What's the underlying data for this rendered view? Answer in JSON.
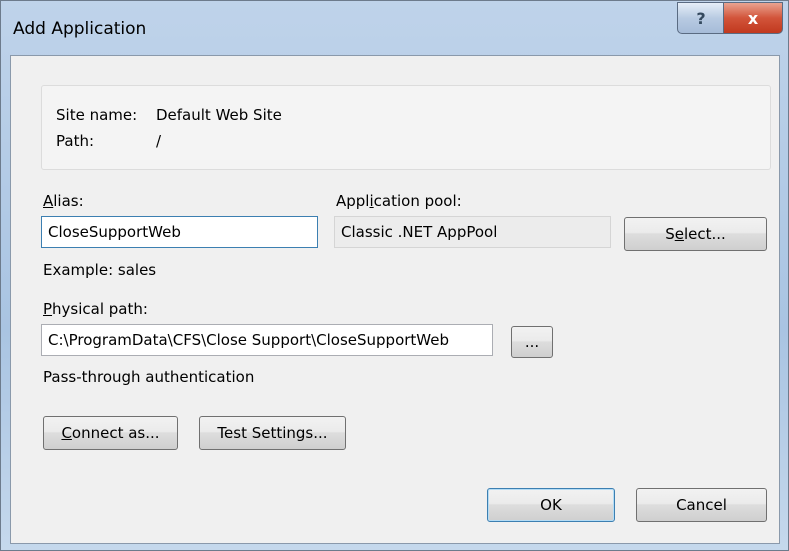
{
  "window": {
    "title": "Add Application",
    "help_glyph": "?",
    "close_glyph": "x"
  },
  "site_info": {
    "site_name_label": "Site name:",
    "site_name_value": "Default Web Site",
    "path_label": "Path:",
    "path_value": "/"
  },
  "alias": {
    "label_accel": "A",
    "label_rest": "lias:",
    "value": "CloseSupportWeb",
    "example": "Example: sales"
  },
  "app_pool": {
    "label_pre": "Appl",
    "label_accel": "i",
    "label_post": "cation pool:",
    "value": "Classic .NET AppPool",
    "select_pre": "S",
    "select_accel": "e",
    "select_post": "lect..."
  },
  "physical_path": {
    "label_accel": "P",
    "label_rest": "hysical path:",
    "value": "C:\\ProgramData\\CFS\\Close Support\\CloseSupportWeb",
    "browse_label": "..."
  },
  "auth": {
    "text": "Pass-through authentication",
    "connect_accel": "C",
    "connect_rest": "onnect as...",
    "test_settings": "Test Settings..."
  },
  "footer": {
    "ok": "OK",
    "cancel": "Cancel"
  }
}
